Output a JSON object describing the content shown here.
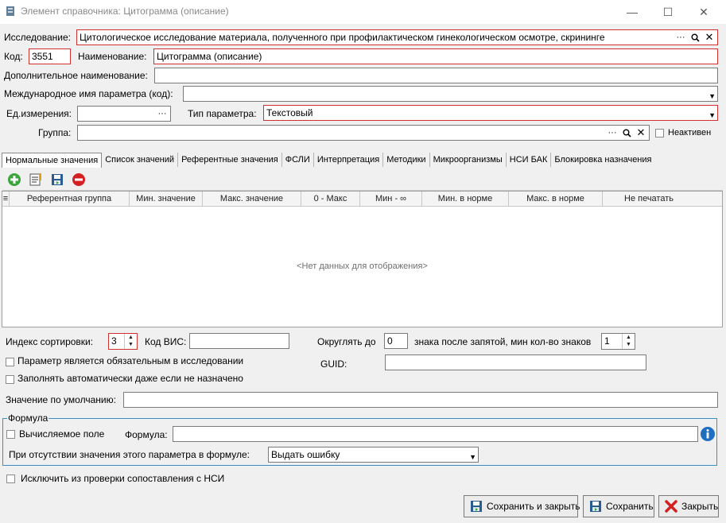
{
  "window": {
    "title": "Элемент справочника: Цитограмма (описание)",
    "buttons": {
      "minimize": "—",
      "maximize": "☐",
      "close": "✕"
    }
  },
  "form": {
    "research_label": "Исследование:",
    "research_value": "Цитологическое исследование материала, полученного при профилактическом гинекологическом осмотре, скрининге",
    "code_label": "Код:",
    "code_value": "3551",
    "name_label": "Наименование:",
    "name_value": "Цитограмма (описание)",
    "extra_name_label": "Дополнительное наименование:",
    "extra_name_value": "",
    "intl_name_label": "Международное имя параметра (код):",
    "intl_name_value": "",
    "unit_label": "Ед.измерения:",
    "unit_value": "",
    "param_type_label": "Тип параметра:",
    "param_type_value": "Текстовый",
    "group_label": "Группа:",
    "group_value": "",
    "inactive_label": "Неактивен"
  },
  "tabs": [
    {
      "label": "Нормальные значения"
    },
    {
      "label": "Список значений"
    },
    {
      "label": "Референтные значения"
    },
    {
      "label": "ФСЛИ"
    },
    {
      "label": "Интерпретация"
    },
    {
      "label": "Методики"
    },
    {
      "label": "Микроорганизмы"
    },
    {
      "label": "НСИ БАК"
    },
    {
      "label": "Блокировка назначения"
    }
  ],
  "grid": {
    "columns": [
      {
        "label": "Референтная группа"
      },
      {
        "label": "Мин. значение"
      },
      {
        "label": "Макс. значение"
      },
      {
        "label": "0 - Макс"
      },
      {
        "label": "Мин - ∞"
      },
      {
        "label": "Мин. в норме"
      },
      {
        "label": "Макс. в норме"
      },
      {
        "label": "Не печатать"
      }
    ],
    "empty_text": "<Нет данных для отображения>"
  },
  "bottom": {
    "sort_index_label": "Индекс сортировки:",
    "sort_index_value": "3",
    "vis_code_label": "Код ВИС:",
    "vis_code_value": "",
    "round_label": "Округлять до",
    "round_value": "0",
    "decimals_label": "знака после запятой, мин кол-во знаков",
    "min_digits_value": "1",
    "required_label": "Параметр является обязательным в исследовании",
    "autofill_label": "Заполнять автоматически даже если не назначено",
    "guid_label": "GUID:",
    "guid_value": "",
    "default_label": "Значение по умолчанию:",
    "default_value": "",
    "formula_group_label": "Формула",
    "computed_label": "Вычисляемое поле",
    "formula_label": "Формула:",
    "formula_value": "",
    "absent_label": "При отсутствии значения этого параметра в формуле:",
    "absent_value": "Выдать ошибку",
    "exclude_label": "Исключить из проверки сопоставления с НСИ"
  },
  "actions": {
    "save_close": "Сохранить и закрыть",
    "save": "Сохранить",
    "close": "Закрыть"
  },
  "colors": {
    "required_border": "#d0302f",
    "accent_blue": "#3a8fc4",
    "add_green": "#3aa63a",
    "delete_red": "#d42020"
  }
}
